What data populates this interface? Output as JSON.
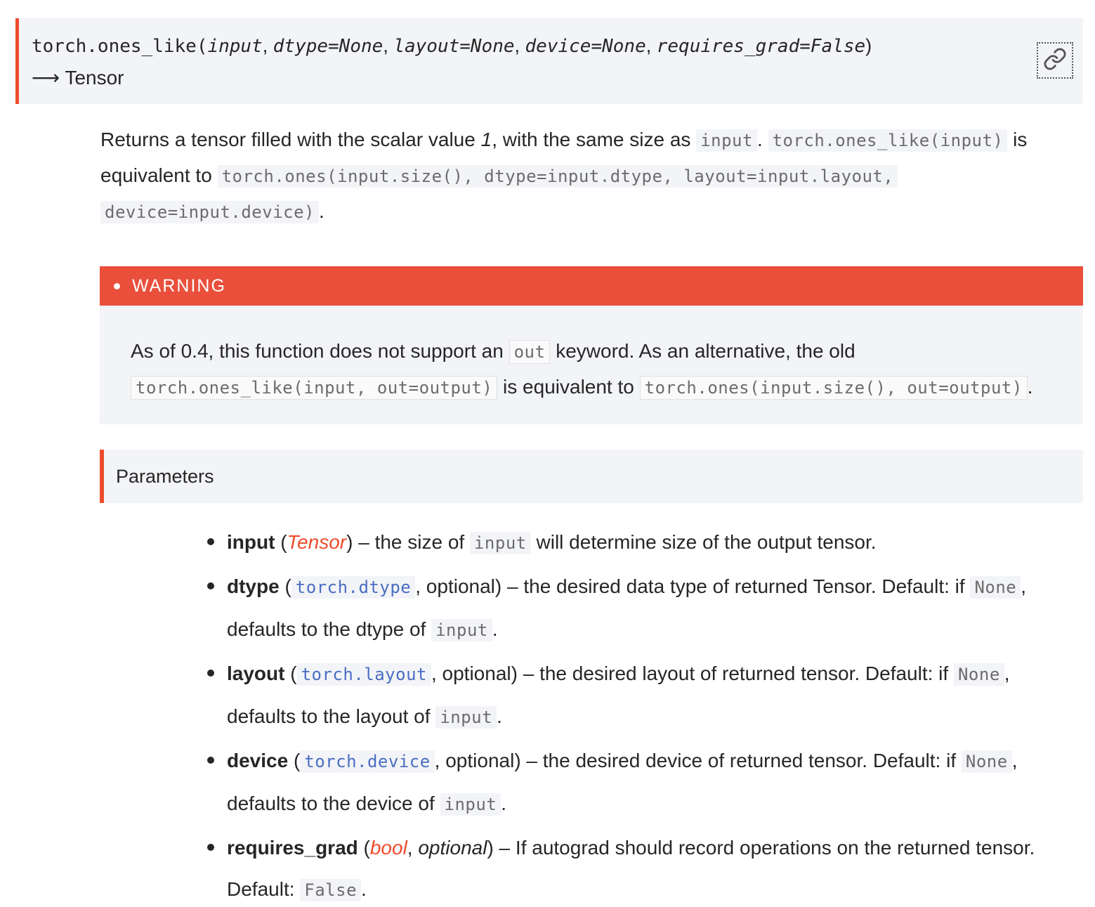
{
  "signature": {
    "func_name": "torch.ones_like",
    "open_paren": "(",
    "params": [
      "input",
      "dtype=None",
      "layout=None",
      "device=None",
      "requires_grad=False"
    ],
    "close_paren": ")",
    "return_arrow": "⟶",
    "return_type": "Tensor",
    "link_icon": "link-icon"
  },
  "description": {
    "t1": "Returns a tensor filled with the scalar value ",
    "value": "1",
    "t2": ", with the same size as ",
    "code_input": "input",
    "t3": ". ",
    "code_call": "torch.ones_like(input)",
    "t4": " is equivalent to ",
    "code_equiv_1": "torch.ones(input.size(), dtype=input.dtype, layout=input.layout,",
    "code_equiv_2": "device=input.device)",
    "t5": "."
  },
  "warning": {
    "title": "WARNING",
    "t1": "As of 0.4, this function does not support an ",
    "code_out": "out",
    "t2": " keyword. As an alternative, the old ",
    "code_old": "torch.ones_like(input, out=output)",
    "t3": " is equivalent to ",
    "code_new": "torch.ones(input.size(), out=output)",
    "t4": "."
  },
  "parameters": {
    "heading": "Parameters",
    "items": [
      {
        "name": "input",
        "type": "Tensor",
        "desc1": " – the size of ",
        "code1": "input",
        "desc2": " will determine size of the output tensor."
      },
      {
        "name": "dtype",
        "type": "torch.dtype",
        "optional": ", optional",
        "desc1": ") – the desired data type of returned Tensor. Default: if ",
        "code1": "None",
        "desc2": ", defaults to the dtype of ",
        "code2": "input",
        "desc3": "."
      },
      {
        "name": "layout",
        "type": "torch.layout",
        "optional": ", optional",
        "desc1": ") – the desired layout of returned tensor. Default: if ",
        "code1": "None",
        "desc2": ", defaults to the layout of ",
        "code2": "input",
        "desc3": "."
      },
      {
        "name": "device",
        "type": "torch.device",
        "optional": ", optional",
        "desc1": ") – the desired device of returned tensor. Default: if ",
        "code1": "None",
        "desc2": ", defaults to the device of ",
        "code2": "input",
        "desc3": "."
      },
      {
        "name": "requires_grad",
        "type": "bool",
        "optional": "optional",
        "desc1": ") – If autograd should record operations on the returned tensor. Default: ",
        "code1": "False",
        "desc2": "."
      }
    ]
  },
  "colors": {
    "accent": "#ee4c2c",
    "warning_bar": "#e94f3b",
    "panel_bg": "#f3f4f7",
    "xref_code": "#4a6ec2"
  }
}
